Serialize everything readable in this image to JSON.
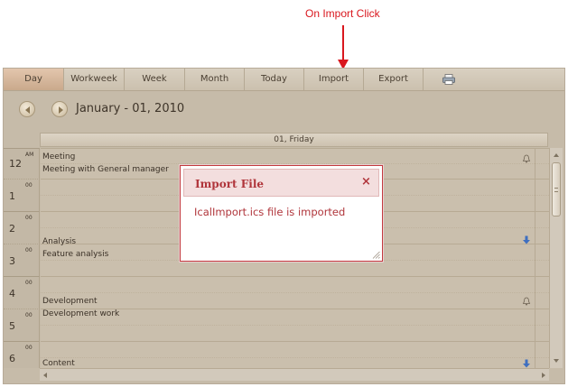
{
  "annotation": {
    "text": "On Import Click",
    "color": "#d9171e"
  },
  "toolbar": {
    "tabs": [
      {
        "label": "Day",
        "active": true
      },
      {
        "label": "Workweek",
        "active": false
      },
      {
        "label": "Week",
        "active": false
      },
      {
        "label": "Month",
        "active": false
      },
      {
        "label": "Today",
        "active": false
      },
      {
        "label": "Import",
        "active": false
      },
      {
        "label": "Export",
        "active": false
      }
    ],
    "print_icon": "printer-icon"
  },
  "date_nav": {
    "prev_icon": "previous-arrow-icon",
    "next_icon": "next-arrow-icon",
    "title": "January - 01, 2010"
  },
  "day_header": {
    "label": "01, Friday"
  },
  "time_slots": [
    {
      "hour": "12",
      "suffix": "AM"
    },
    {
      "hour": "1",
      "suffix": "00"
    },
    {
      "hour": "2",
      "suffix": "00"
    },
    {
      "hour": "3",
      "suffix": "00"
    },
    {
      "hour": "4",
      "suffix": "00"
    },
    {
      "hour": "5",
      "suffix": "00"
    },
    {
      "hour": "6",
      "suffix": "00"
    }
  ],
  "appointments": [
    {
      "subject": "Meeting",
      "description": "Meeting with General manager",
      "icon": "reminder-bell-icon"
    },
    {
      "subject": "Analysis",
      "description": "Feature analysis",
      "icon": "down-arrow-icon"
    },
    {
      "subject": "Development",
      "description": "Development work",
      "icon": "reminder-bell-icon"
    },
    {
      "subject": "Content",
      "description": "",
      "icon": "down-arrow-icon"
    }
  ],
  "dialog": {
    "title": "Import File",
    "close_label": "×",
    "message": "IcalImport.ics file is imported",
    "accent_color": "#b0353b"
  },
  "colors": {
    "scheduler_bg": "#c6bba9",
    "active_tab": "#d4b79c"
  }
}
